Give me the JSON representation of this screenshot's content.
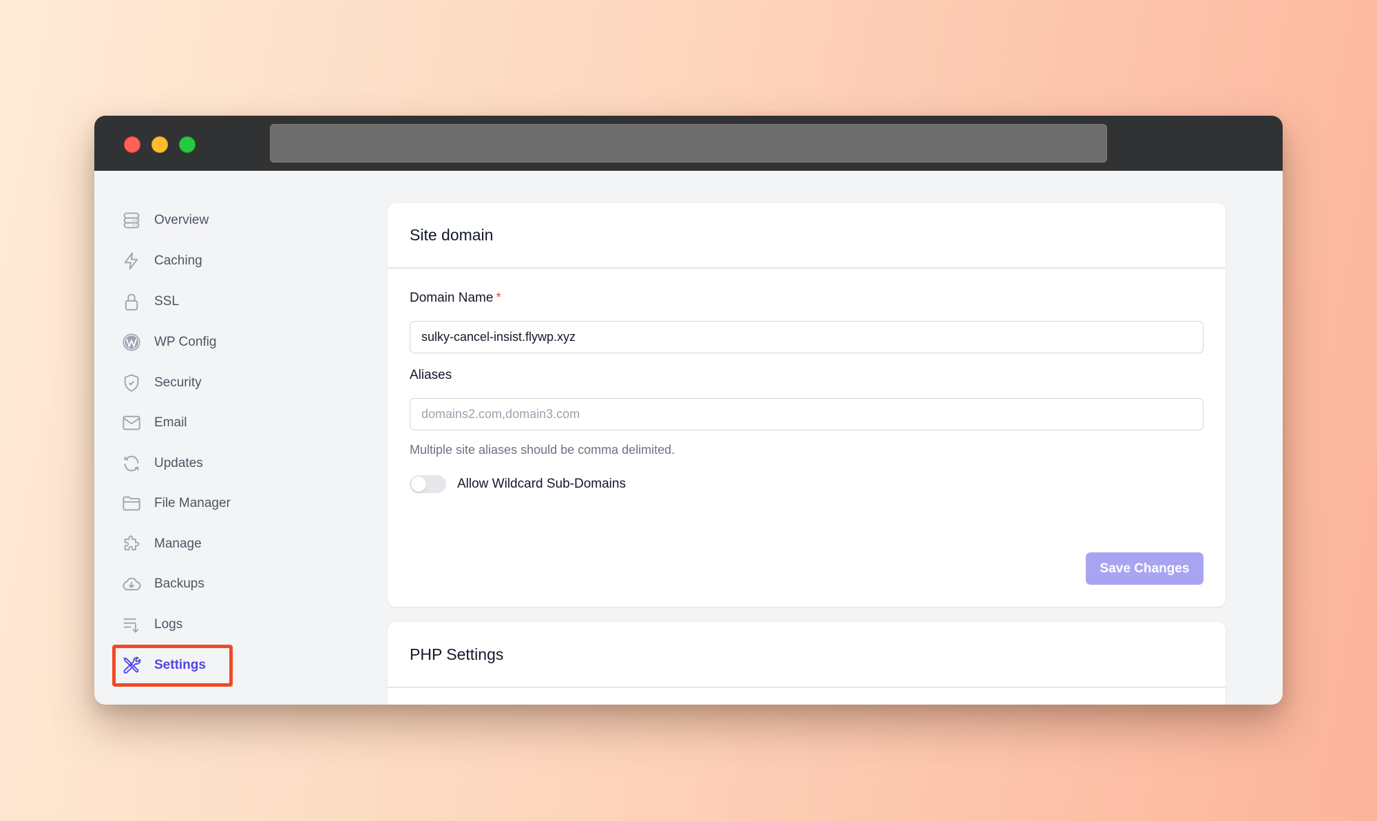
{
  "window": {
    "controls": [
      "close",
      "minimize",
      "maximize"
    ],
    "url": ""
  },
  "sidebar": {
    "items": [
      {
        "label": "Overview",
        "icon": "server-icon",
        "active": false
      },
      {
        "label": "Caching",
        "icon": "lightning-icon",
        "active": false
      },
      {
        "label": "SSL",
        "icon": "lock-icon",
        "active": false
      },
      {
        "label": "WP Config",
        "icon": "wordpress-icon",
        "active": false
      },
      {
        "label": "Security",
        "icon": "shield-check-icon",
        "active": false
      },
      {
        "label": "Email",
        "icon": "envelope-icon",
        "active": false
      },
      {
        "label": "Updates",
        "icon": "refresh-icon",
        "active": false
      },
      {
        "label": "File Manager",
        "icon": "folder-icon",
        "active": false
      },
      {
        "label": "Manage",
        "icon": "puzzle-icon",
        "active": false
      },
      {
        "label": "Backups",
        "icon": "cloud-download-icon",
        "active": false
      },
      {
        "label": "Logs",
        "icon": "list-sort-icon",
        "active": false
      },
      {
        "label": "Settings",
        "icon": "wrench-screwdriver-icon",
        "active": true
      }
    ]
  },
  "site_domain": {
    "title": "Site domain",
    "domain_name": {
      "label": "Domain Name",
      "required_mark": "*",
      "value": "sulky-cancel-insist.flywp.xyz"
    },
    "aliases": {
      "label": "Aliases",
      "value": "",
      "placeholder": "domains2.com,domain3.com",
      "help": "Multiple site aliases should be comma delimited."
    },
    "wildcard": {
      "label": "Allow Wildcard Sub-Domains",
      "enabled": false
    },
    "save_label": "Save Changes"
  },
  "php_settings": {
    "title": "PHP Settings"
  },
  "colors": {
    "accent": "#4f46e5",
    "save_button": "#a9a4f1",
    "highlight": "#f04a25",
    "required": "#ef4444"
  }
}
